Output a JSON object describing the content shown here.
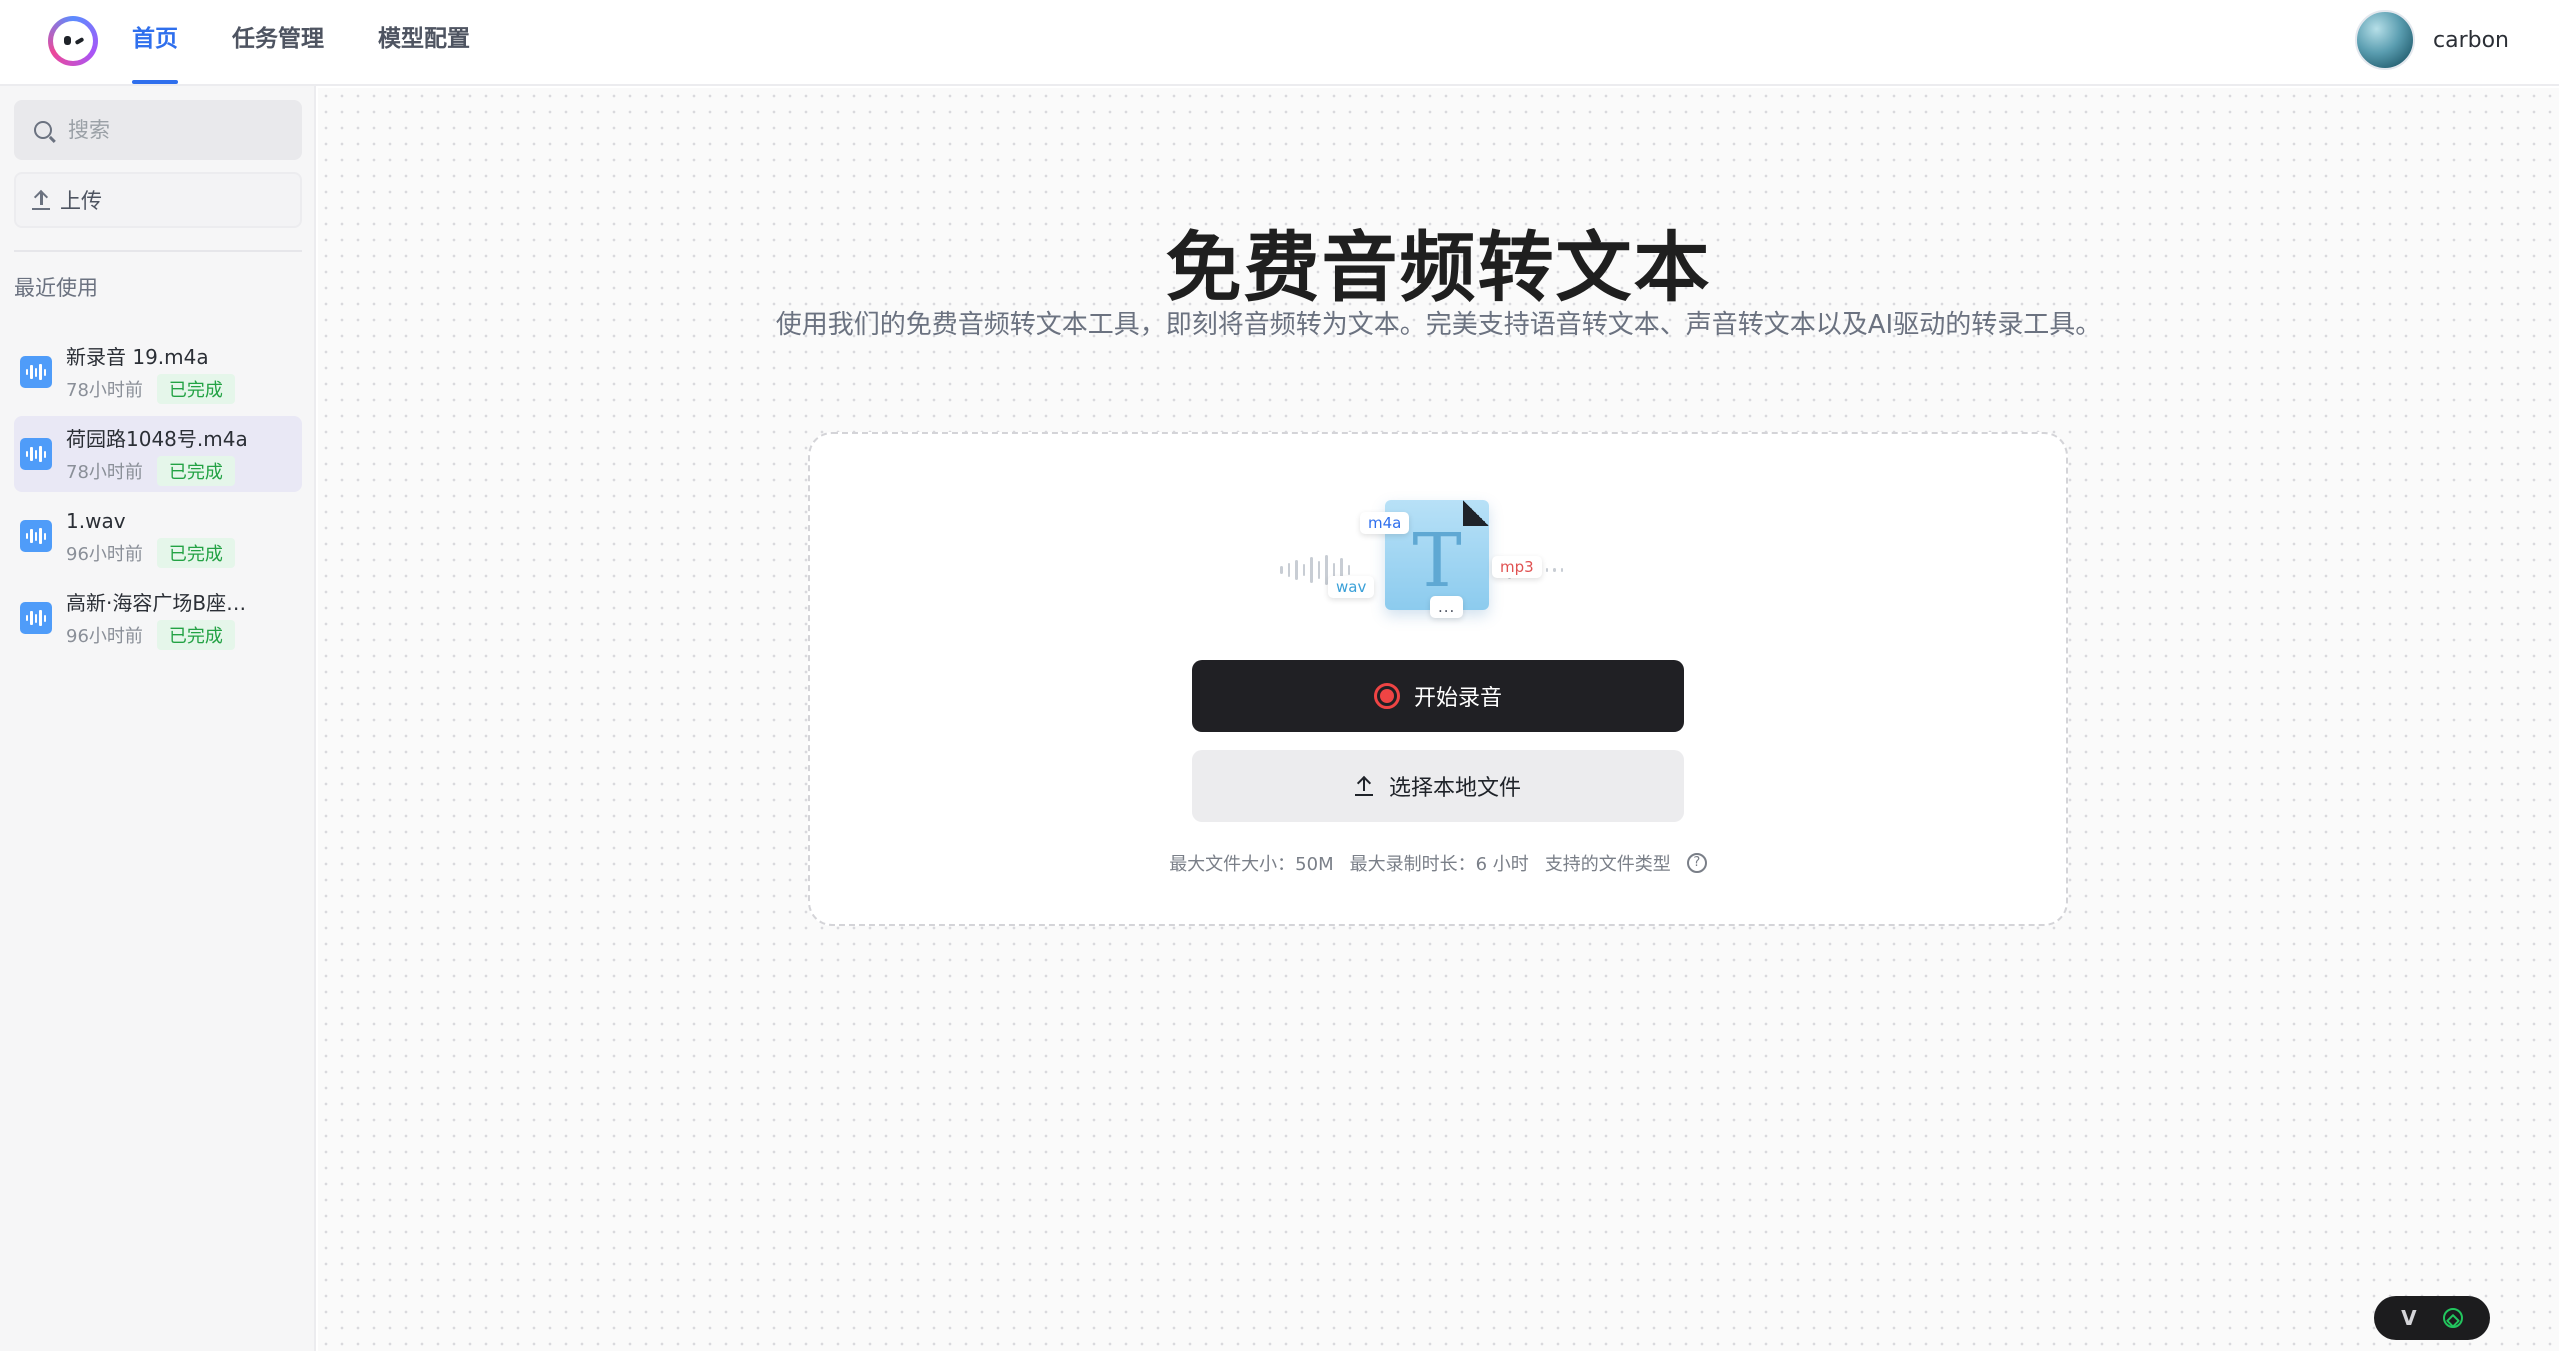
{
  "header": {
    "nav": [
      {
        "label": "首页",
        "active": true
      },
      {
        "label": "任务管理",
        "active": false
      },
      {
        "label": "模型配置",
        "active": false
      }
    ],
    "username": "carbon",
    "accent_color": "#2f6fed"
  },
  "sidebar": {
    "search_placeholder": "搜索",
    "upload_label": "上传",
    "recent_title": "最近使用",
    "recent": [
      {
        "name": "新录音 19.m4a",
        "time": "78小时前",
        "status": "已完成",
        "selected": false
      },
      {
        "name": "荷园路1048号.m4a",
        "time": "78小时前",
        "status": "已完成",
        "selected": true
      },
      {
        "name": "1.wav",
        "time": "96小时前",
        "status": "已完成",
        "selected": false
      },
      {
        "name": "高新·海容广场B座…",
        "time": "96小时前",
        "status": "已完成",
        "selected": false
      }
    ]
  },
  "main": {
    "title": "免费音频转文本",
    "subtitle": "使用我们的免费音频转文本工具，即刻将音频转为文本。完美支持语音转文本、声音转文本以及AI驱动的转录工具。",
    "illustration": {
      "tags": [
        "m4a",
        "wav",
        "mp3",
        "..."
      ],
      "glyph": "T"
    },
    "record_button": "开始录音",
    "local_button": "选择本地文件",
    "limits": {
      "max_size": "最大文件大小：50M",
      "max_duration": "最大录制时长：6 小时",
      "file_types": "支持的文件类型",
      "help_glyph": "?"
    }
  },
  "widget": {
    "left_glyph": "V"
  }
}
